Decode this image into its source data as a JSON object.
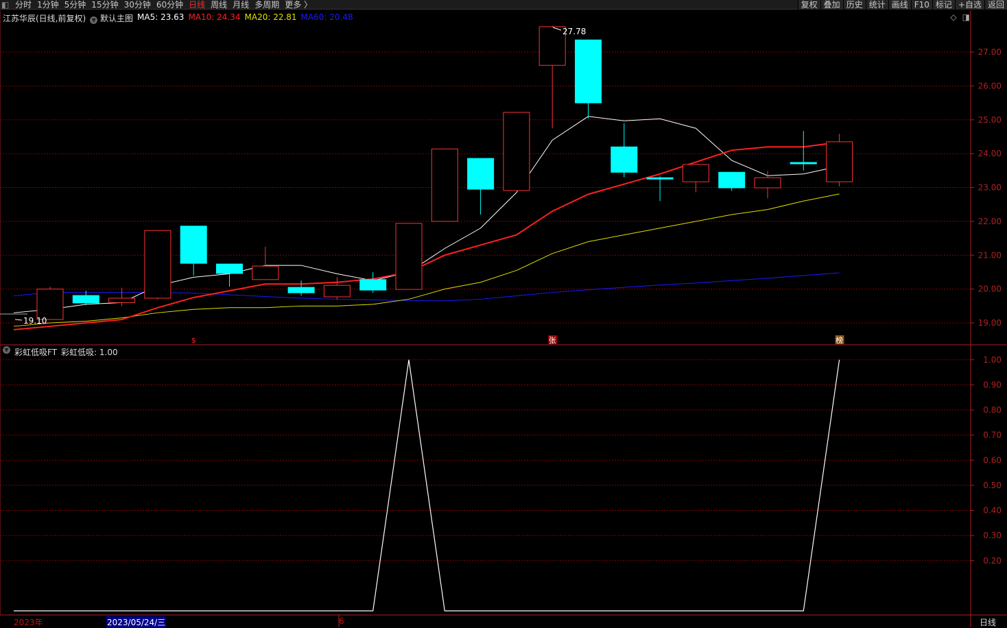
{
  "toolbar": {
    "tabs": [
      "分时",
      "1分钟",
      "5分钟",
      "15分钟",
      "30分钟",
      "60分钟",
      "日线",
      "周线",
      "月线",
      "多周期",
      "更多 〉"
    ],
    "active": "日线",
    "right_buttons": [
      "复权",
      "叠加",
      "历史",
      "统计",
      "画线",
      "F10",
      "标记",
      "+自选",
      "返回"
    ]
  },
  "legend": {
    "title": "江苏华辰(日线,前复权)",
    "template": "默认主图",
    "ma5": "MA5: 23.63",
    "ma10": "MA10: 24.34",
    "ma20": "MA20: 22.81",
    "ma60": "MA60: 20.48"
  },
  "indicator": {
    "name": "彩虹低吸FT",
    "value": "彩虹低吸: 1.00"
  },
  "colors": {
    "up": "#ff3232",
    "down": "#00ffff",
    "ma5": "#ffffff",
    "ma10": "#ff2020",
    "ma20": "#e0e000",
    "ma60": "#1a1aff",
    "grid": "#8b0000",
    "axis": "#b02020"
  },
  "annotations": {
    "high": "27.78",
    "low": "19.10",
    "signals": [
      {
        "index": 4,
        "text": "$",
        "bg": "#000",
        "color": "#ff2020"
      },
      {
        "index": 14,
        "text": "张",
        "bg": "#9a0000",
        "color": "#fff"
      },
      {
        "index": 22,
        "text": "榜",
        "bg": "#8a5010",
        "color": "#fff"
      }
    ]
  },
  "bottom": {
    "year": "2023年",
    "cursor_date": "2023/05/24/三",
    "month": "6",
    "period": "日线"
  },
  "chart_data": [
    {
      "type": "candlestick",
      "title": "江苏华辰(日线,前复权)",
      "ylim": [
        18.6,
        28.1
      ],
      "yticks": [
        "27.00",
        "26.00",
        "25.00",
        "24.00",
        "23.00",
        "22.00",
        "21.00",
        "20.00",
        "19.00"
      ],
      "candles": [
        [
          19.1,
          20.0,
          20.07,
          19.1
        ],
        [
          19.81,
          19.59,
          19.95,
          19.52
        ],
        [
          19.6,
          19.73,
          20.04,
          19.49
        ],
        [
          19.73,
          21.73,
          21.73,
          19.69
        ],
        [
          21.86,
          20.76,
          21.86,
          20.4
        ],
        [
          20.74,
          20.46,
          20.74,
          20.07
        ],
        [
          20.28,
          20.68,
          21.25,
          20.28
        ],
        [
          20.05,
          19.89,
          20.25,
          19.8
        ],
        [
          19.77,
          20.11,
          20.35,
          19.69
        ],
        [
          20.28,
          19.97,
          20.5,
          19.89
        ],
        [
          19.99,
          21.94,
          21.94,
          19.99
        ],
        [
          22.0,
          24.14,
          24.14,
          22.0
        ],
        [
          23.86,
          22.95,
          23.86,
          22.2
        ],
        [
          22.91,
          25.22,
          25.22,
          22.91
        ],
        [
          26.61,
          27.75,
          27.78,
          24.75
        ],
        [
          27.36,
          25.5,
          27.36,
          25.04
        ],
        [
          24.2,
          23.45,
          24.9,
          23.3
        ],
        [
          23.29,
          23.25,
          23.33,
          22.6
        ],
        [
          23.17,
          23.68,
          23.68,
          22.86
        ],
        [
          23.45,
          22.99,
          23.45,
          22.9
        ],
        [
          22.99,
          23.29,
          23.49,
          22.68
        ],
        [
          23.74,
          23.7,
          24.67,
          23.5
        ],
        [
          23.17,
          24.35,
          24.59,
          23.03
        ]
      ],
      "ma5": [
        19.4,
        19.55,
        19.6,
        20.1,
        20.35,
        20.45,
        20.7,
        20.7,
        20.45,
        20.25,
        20.5,
        21.2,
        21.8,
        22.85,
        24.4,
        25.1,
        24.97,
        25.03,
        24.75,
        23.8,
        23.35,
        23.4,
        23.63
      ],
      "ma10": [
        18.9,
        19.0,
        19.1,
        19.45,
        19.75,
        19.95,
        20.15,
        20.15,
        20.2,
        20.3,
        20.5,
        21.0,
        21.3,
        21.6,
        22.3,
        22.8,
        23.1,
        23.4,
        23.75,
        24.1,
        24.2,
        24.2,
        24.34
      ],
      "ma20": [
        19.0,
        19.05,
        19.15,
        19.3,
        19.4,
        19.45,
        19.45,
        19.5,
        19.5,
        19.55,
        19.7,
        20.0,
        20.2,
        20.55,
        21.05,
        21.4,
        21.6,
        21.8,
        22.0,
        22.2,
        22.35,
        22.6,
        22.81
      ],
      "ma60": [
        19.9,
        19.9,
        19.9,
        19.9,
        19.88,
        19.83,
        19.78,
        19.73,
        19.7,
        19.68,
        19.66,
        19.65,
        19.7,
        19.8,
        19.9,
        19.98,
        20.05,
        20.12,
        20.18,
        20.25,
        20.32,
        20.4,
        20.48
      ]
    },
    {
      "type": "line",
      "title": "彩虹低吸FT",
      "ylim": [
        0,
        1.05
      ],
      "yticks": [
        "1.00",
        "0.90",
        "0.80",
        "0.70",
        "0.60",
        "0.50",
        "0.40",
        "0.30",
        "0.20"
      ],
      "values": [
        0,
        0,
        0,
        0,
        0,
        0,
        0,
        0,
        0,
        0,
        1,
        0,
        0,
        0,
        0,
        0,
        0,
        0,
        0,
        0,
        0,
        0,
        1
      ]
    }
  ]
}
